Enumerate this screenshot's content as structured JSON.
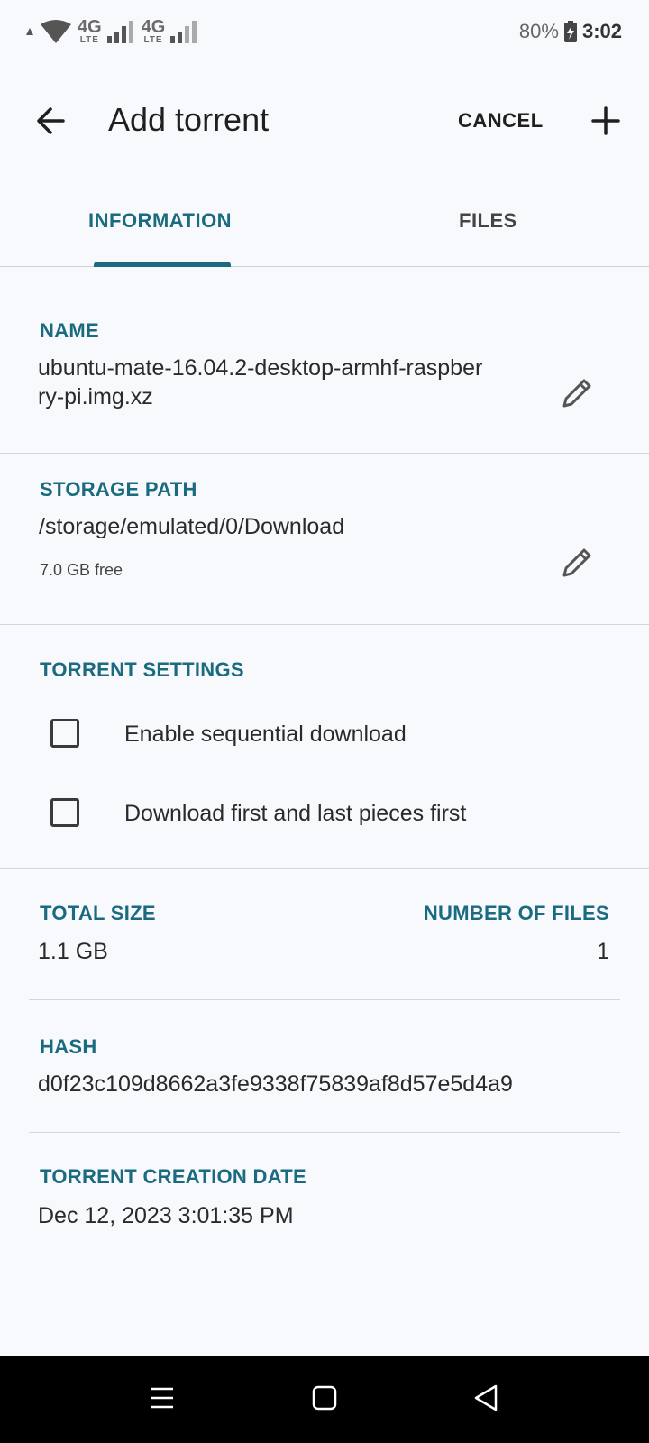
{
  "status_bar": {
    "network1": {
      "gen": "4G",
      "type": "LTE"
    },
    "network2": {
      "gen": "4G",
      "type": "LTE"
    },
    "battery": "80%",
    "time": "3:02"
  },
  "app_bar": {
    "title": "Add torrent",
    "cancel_label": "CANCEL"
  },
  "tabs": [
    {
      "label": "INFORMATION",
      "selected": true
    },
    {
      "label": "FILES",
      "selected": false
    }
  ],
  "name": {
    "label": "NAME",
    "line1": "ubuntu-mate-16.04.2-desktop-armhf-raspber",
    "line2": "ry-pi.img.xz"
  },
  "storage": {
    "label": "STORAGE PATH",
    "path": "/storage/emulated/0/Download",
    "free": "7.0 GB free"
  },
  "settings": {
    "label": "TORRENT SETTINGS",
    "options": [
      {
        "label": "Enable sequential download",
        "checked": false
      },
      {
        "label": "Download first and last pieces first",
        "checked": false
      }
    ]
  },
  "size": {
    "label": "TOTAL SIZE",
    "value": "1.1 GB"
  },
  "files_count": {
    "label": "NUMBER OF FILES",
    "value": "1"
  },
  "hash": {
    "label": "HASH",
    "value": "d0f23c109d8662a3fe9338f75839af8d57e5d4a9"
  },
  "creation_date": {
    "label": "TORRENT CREATION DATE",
    "value": "Dec 12, 2023 3:01:35 PM"
  },
  "colors": {
    "accent": "#1b6b80",
    "background": "#f8f9fc"
  }
}
